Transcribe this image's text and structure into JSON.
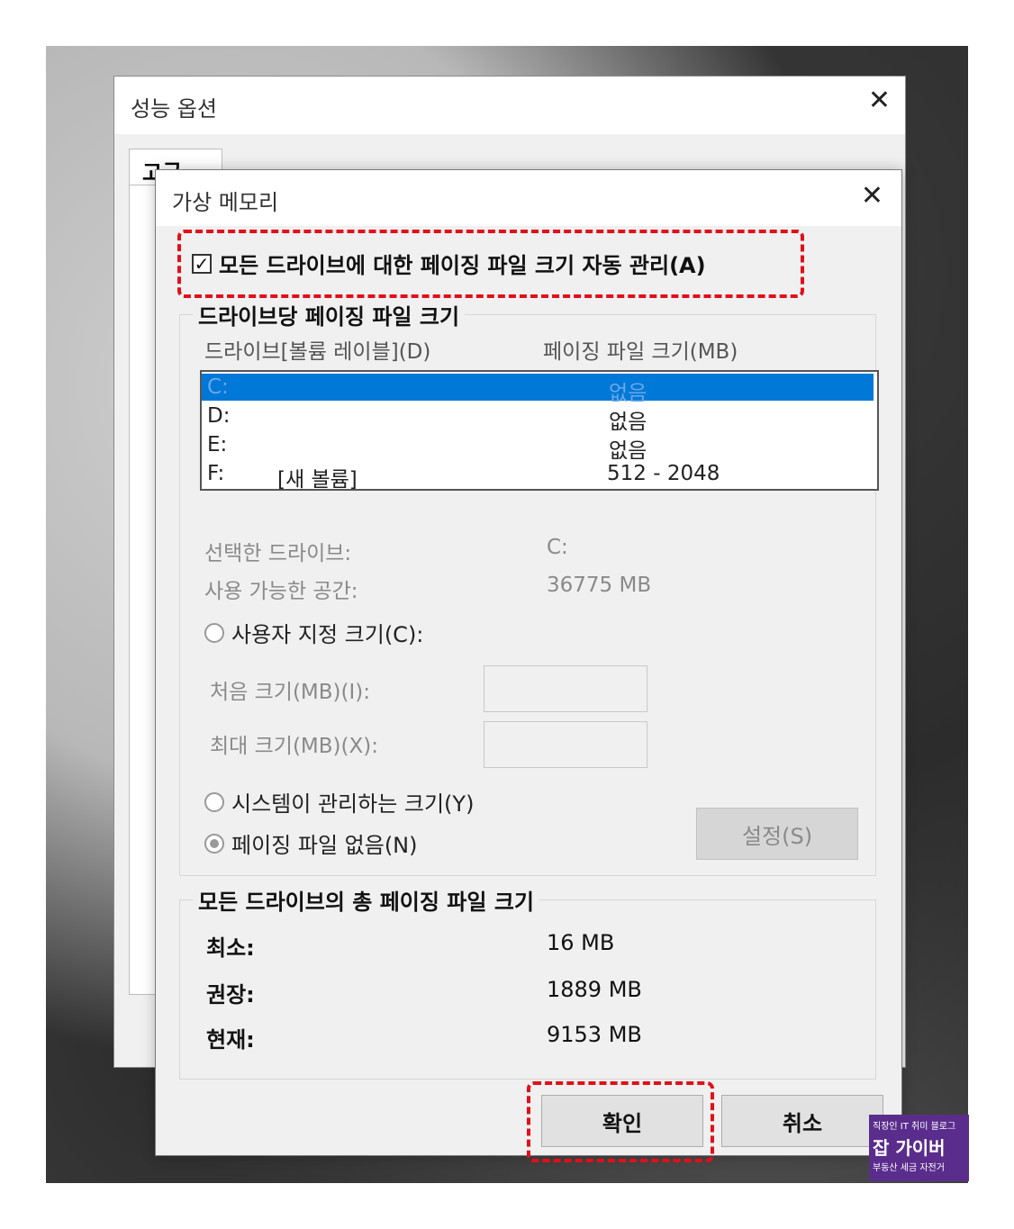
{
  "performance_options": {
    "title": "성능 옵션",
    "close_glyph": "✕",
    "tab_label": "고급"
  },
  "virtual_memory": {
    "title": "가상 메모리",
    "close_glyph": "✕",
    "auto_manage": {
      "label": "모든 드라이브에 대한 페이징 파일 크기 자동 관리(A)",
      "checked": true
    },
    "per_drive_group": {
      "legend": "드라이브당 페이징 파일 크기",
      "col_drive": "드라이브[볼륨 레이블](D)",
      "col_size": "페이징 파일 크기(MB)",
      "drives": [
        {
          "drive": "C:",
          "label": "",
          "size": "없음",
          "selected": true
        },
        {
          "drive": "D:",
          "label": "",
          "size": "없음",
          "selected": false
        },
        {
          "drive": "E:",
          "label": "",
          "size": "없음",
          "selected": false
        },
        {
          "drive": "F:",
          "label": "[새 볼륨]",
          "size": "512 - 2048",
          "selected": false
        }
      ],
      "selected_drive_label": "선택한 드라이브:",
      "selected_drive_value": "C:",
      "free_space_label": "사용 가능한 공간:",
      "free_space_value": "36775 MB",
      "custom_size_label": "사용자 지정 크기(C):",
      "initial_size_label": "처음 크기(MB)(I):",
      "initial_size_value": "",
      "max_size_label": "최대 크기(MB)(X):",
      "max_size_value": "",
      "system_managed_label": "시스템이 관리하는 크기(Y)",
      "no_paging_label": "페이징 파일 없음(N)",
      "set_button": "설정(S)"
    },
    "total_group": {
      "legend": "모든 드라이브의 총 페이징 파일 크기",
      "min_label": "최소:",
      "min_value": "16 MB",
      "recommended_label": "권장:",
      "recommended_value": "1889 MB",
      "current_label": "현재:",
      "current_value": "9153 MB"
    },
    "ok_button": "확인",
    "cancel_button": "취소"
  },
  "watermark": {
    "line1": "직장인 IT 취미 블로그",
    "line2": "잡 가이버",
    "line3": "부동산 세금 자전거"
  },
  "colors": {
    "selection": "#0078d7",
    "highlight_dash": "#e0101a"
  }
}
